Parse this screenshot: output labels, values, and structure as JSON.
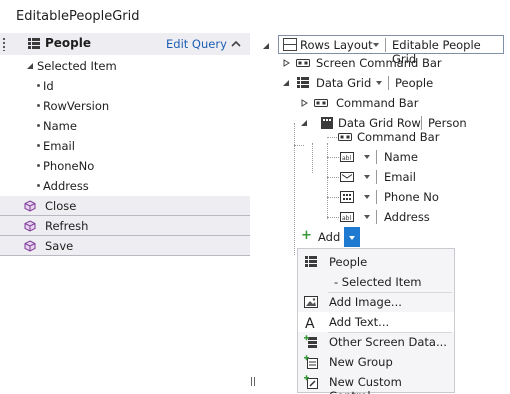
{
  "window": {
    "title": "EditablePeopleGrid"
  },
  "left_panel": {
    "header": {
      "label": "People",
      "edit_link": "Edit Query"
    },
    "selected_item": "Selected Item",
    "fields": [
      "Id",
      "RowVersion",
      "Name",
      "Email",
      "PhoneNo",
      "Address"
    ],
    "commands": [
      "Close",
      "Refresh",
      "Save"
    ]
  },
  "right_panel": {
    "root": {
      "label": "Rows Layout",
      "value": "Editable People Grid"
    },
    "screen_command_bar": "Screen Command Bar",
    "data_grid": {
      "label": "Data Grid",
      "value": "People"
    },
    "command_bar": "Command Bar",
    "data_grid_row": {
      "label": "Data Grid Row",
      "value": "Person"
    },
    "row_command_bar": "Command Bar",
    "columns": [
      "Name",
      "Email",
      "Phone No",
      "Address"
    ],
    "add_button": "Add"
  },
  "add_menu": {
    "items": [
      {
        "label": "People",
        "icon": "grid-icon"
      },
      {
        "label": "- Selected Item",
        "icon": ""
      },
      {
        "label": "Add Image...",
        "icon": "image-icon"
      },
      {
        "label": "Add Text...",
        "icon": "text-a-icon"
      },
      {
        "label": "Other Screen Data...",
        "icon": "data-plus-icon"
      },
      {
        "label": "New Group",
        "icon": "group-plus-icon"
      },
      {
        "label": "New Custom Control...",
        "icon": "custom-control-icon"
      }
    ]
  },
  "colors": {
    "accent": "#1e7ad0",
    "link": "#1e5fb4",
    "panel_header": "#eeeef2"
  }
}
